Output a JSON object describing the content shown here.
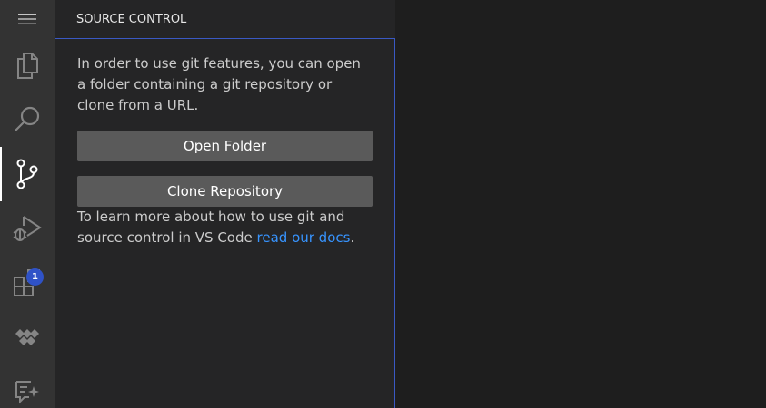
{
  "activity_bar": {
    "items": [
      {
        "name": "menu",
        "icon": "hamburger-menu-icon"
      },
      {
        "name": "explorer",
        "icon": "files-icon"
      },
      {
        "name": "search",
        "icon": "search-icon"
      },
      {
        "name": "source-control",
        "icon": "source-control-icon",
        "active": true
      },
      {
        "name": "run-and-debug",
        "icon": "run-debug-icon"
      },
      {
        "name": "extensions",
        "icon": "extensions-icon",
        "badge": "1"
      },
      {
        "name": "remote",
        "icon": "remote-explorer-icon"
      },
      {
        "name": "chat",
        "icon": "chat-sparkle-icon"
      }
    ],
    "extensions_badge": "1"
  },
  "sidebar": {
    "title": "SOURCE CONTROL",
    "intro_text": "In order to use git features, you can open a folder containing a git repository or clone from a URL.",
    "open_folder_label": "Open Folder",
    "clone_repository_label": "Clone Repository",
    "learn_text": "To learn more about how to use git and source control in VS Code ",
    "learn_link": "read our docs",
    "learn_suffix": "."
  },
  "colors": {
    "activity_bar_bg": "#333333",
    "sidebar_bg": "#252526",
    "editor_bg": "#1e1e1e",
    "button_bg": "#5a5a5a",
    "link": "#3794ff",
    "focus_border": "#3a59c4",
    "badge_bg": "#2f52c7"
  }
}
